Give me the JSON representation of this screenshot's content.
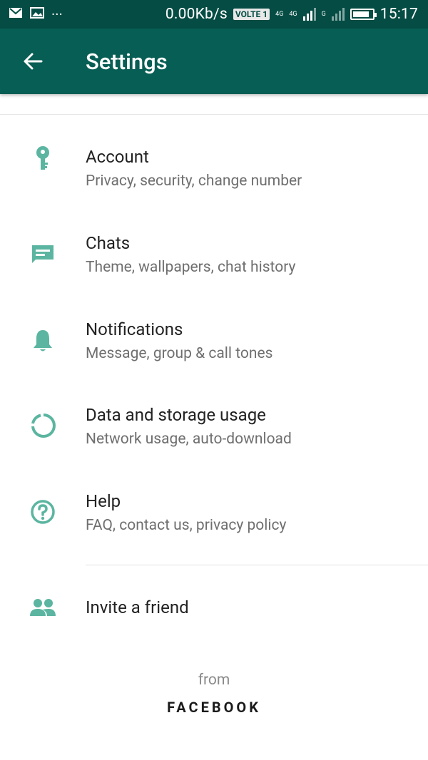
{
  "status_bar": {
    "network_speed": "0.00Kb/s",
    "volte_label": "VOLTE",
    "sim1_label": "1",
    "net1_label": "4G",
    "net2_label": "4G",
    "net3_label": "G",
    "time": "15:17",
    "battery_level_percent": 85
  },
  "app_bar": {
    "title": "Settings"
  },
  "settings": {
    "items": [
      {
        "title": "Account",
        "subtitle": "Privacy, security, change number",
        "icon": "key-icon"
      },
      {
        "title": "Chats",
        "subtitle": "Theme, wallpapers, chat history",
        "icon": "chat-icon"
      },
      {
        "title": "Notifications",
        "subtitle": "Message, group & call tones",
        "icon": "bell-icon"
      },
      {
        "title": "Data and storage usage",
        "subtitle": "Network usage, auto-download",
        "icon": "data-usage-icon"
      },
      {
        "title": "Help",
        "subtitle": "FAQ, contact us, privacy policy",
        "icon": "help-icon"
      }
    ],
    "invite": {
      "title": "Invite a friend",
      "icon": "people-icon"
    }
  },
  "footer": {
    "from_label": "from",
    "brand": "FACEBOOK"
  },
  "colors": {
    "status_bar": "#054d44",
    "app_bar": "#075e54",
    "icon": "#5bb5a0",
    "title_text": "#222222",
    "subtitle_text": "#6f6f6f"
  }
}
